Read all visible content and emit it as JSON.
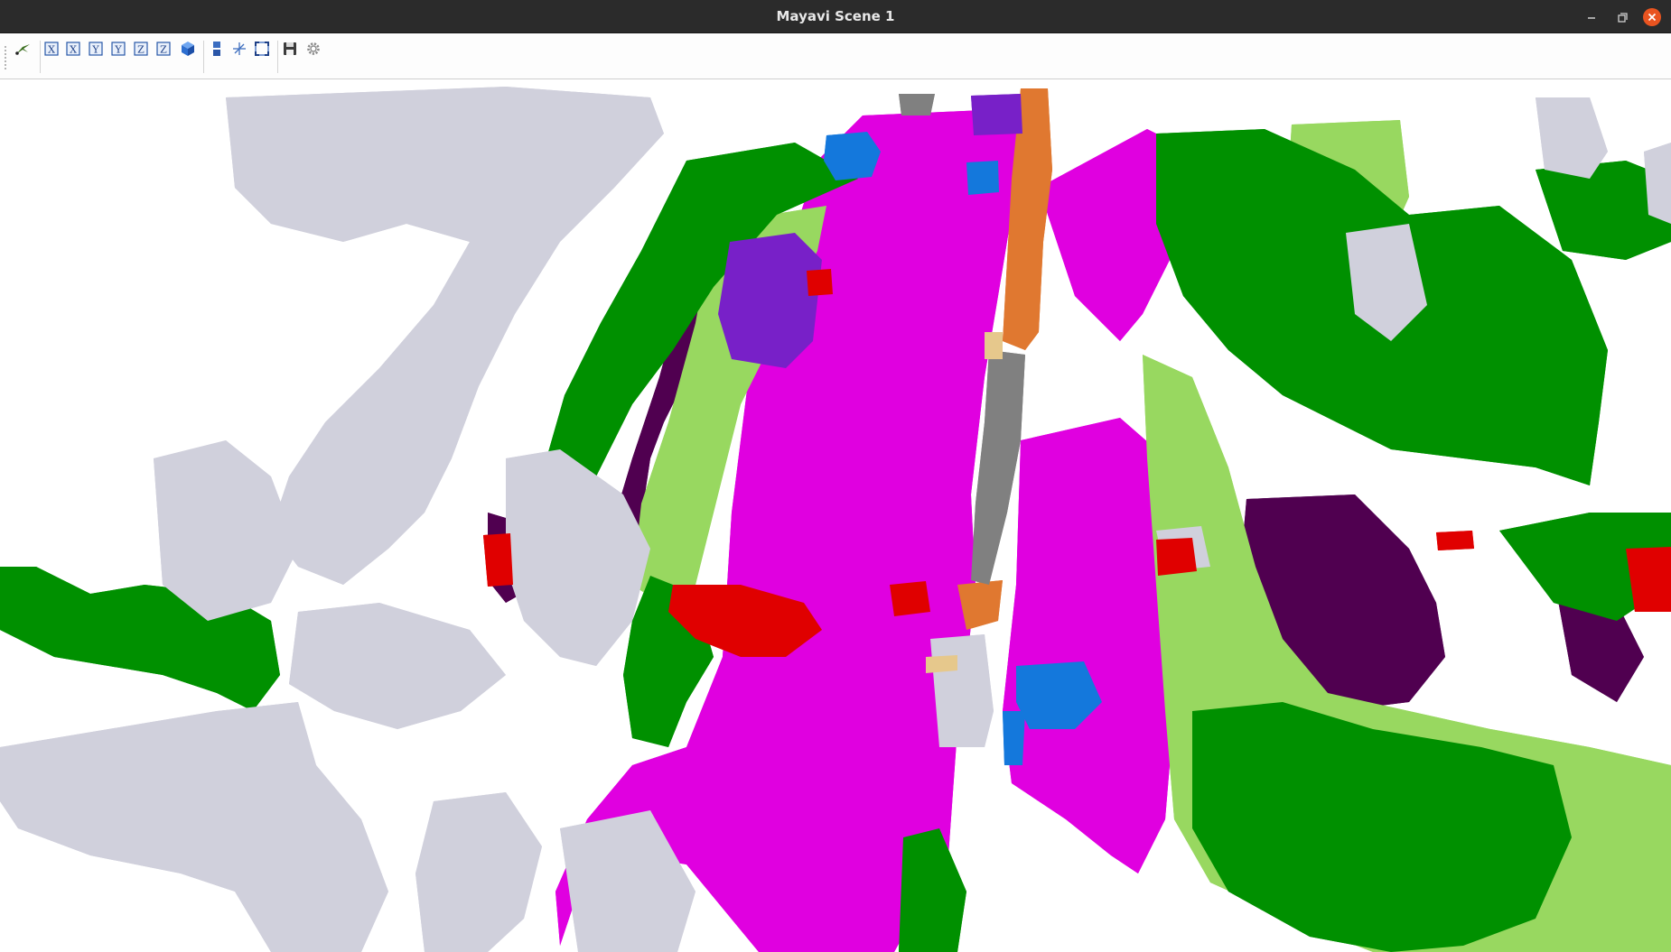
{
  "window": {
    "title": "Mayavi Scene 1"
  },
  "toolbar": {
    "buttons": [
      {
        "name": "mayavi-pipeline-button",
        "icon": "mayavi-logo-icon"
      },
      {
        "name": "view-plus-x-button",
        "icon": "view-x-icon",
        "glyph": "X"
      },
      {
        "name": "view-minus-x-button",
        "icon": "view-x-icon",
        "glyph": "X"
      },
      {
        "name": "view-plus-y-button",
        "icon": "view-y-icon",
        "glyph": "Y"
      },
      {
        "name": "view-minus-y-button",
        "icon": "view-y-icon",
        "glyph": "Y"
      },
      {
        "name": "view-plus-z-button",
        "icon": "view-z-icon",
        "glyph": "Z"
      },
      {
        "name": "view-minus-z-button",
        "icon": "view-z-icon",
        "glyph": "Z"
      },
      {
        "name": "isometric-view-button",
        "icon": "cube-icon"
      },
      {
        "name": "toggle-parallel-projection-button",
        "icon": "parallel-projection-icon"
      },
      {
        "name": "toggle-axes-indicator-button",
        "icon": "axes-icon"
      },
      {
        "name": "full-screen-button",
        "icon": "fullscreen-icon"
      },
      {
        "name": "save-scene-button",
        "icon": "save-icon"
      },
      {
        "name": "configure-scene-button",
        "icon": "gear-icon"
      }
    ]
  },
  "scene": {
    "type": "3d-voxel-semantic-occupancy",
    "class_colors": {
      "road": "#e000e0",
      "vegetation": "#009000",
      "terrain": "#98d860",
      "building": "#d0d0dc",
      "car": "#e00000",
      "truck": "#7820c8",
      "sidewalk": "#500050",
      "pole": "#e07830",
      "fence": "#808080",
      "other-vehicle": "#1478dc",
      "traffic-sign": "#e6c88c"
    }
  }
}
